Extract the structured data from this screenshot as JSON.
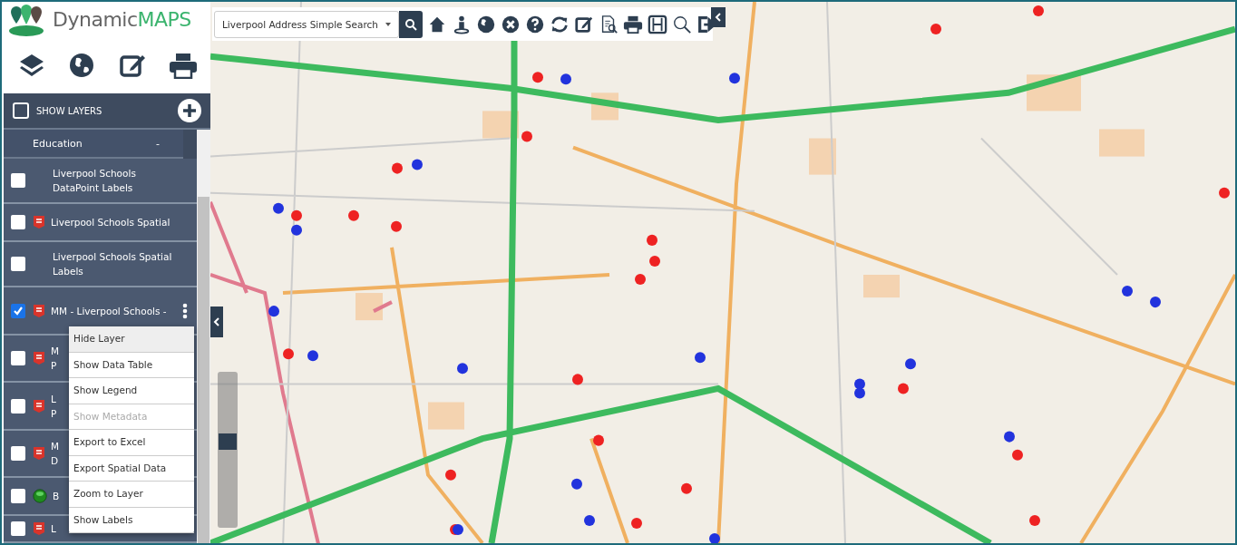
{
  "logo": {
    "part1": "Dynamic",
    "part2": "MAPS"
  },
  "search_source": {
    "value": "Liverpool Address Simple Search"
  },
  "zoom_slider": {
    "level": 0.55
  },
  "layers_panel": {
    "show_layers": {
      "label": "SHOW LAYERS",
      "checked": false
    },
    "group": {
      "label": "Education",
      "toggle": "-"
    },
    "layers": [
      {
        "lines": [
          "Liverpool Schools",
          "DataPoint Labels"
        ],
        "checked": false,
        "kind": "plain"
      },
      {
        "lines": [
          "Liverpool Schools Spatial"
        ],
        "checked": false,
        "kind": "school"
      },
      {
        "lines": [
          "Liverpool Schools Spatial",
          "Labels"
        ],
        "checked": false,
        "kind": "plain"
      },
      {
        "lines": [
          "MM - Liverpool Schools -"
        ],
        "checked": true,
        "kind": "school"
      },
      {
        "lines": [
          "M",
          "P"
        ],
        "checked": false,
        "kind": "school"
      },
      {
        "lines": [
          "L",
          "P"
        ],
        "checked": false,
        "kind": "school"
      },
      {
        "lines": [
          "M",
          "D"
        ],
        "checked": false,
        "kind": "school"
      },
      {
        "lines": [
          "B"
        ],
        "checked": false,
        "kind": "point"
      },
      {
        "lines": [
          "L"
        ],
        "checked": false,
        "kind": "school"
      }
    ]
  },
  "layer_menu": [
    {
      "label": "Hide Layer",
      "selected": true,
      "disabled": false
    },
    {
      "label": "Show Data Table",
      "selected": false,
      "disabled": false
    },
    {
      "label": "Show Legend",
      "selected": false,
      "disabled": false
    },
    {
      "label": "Show Metadata",
      "selected": false,
      "disabled": true
    },
    {
      "label": "Export to Excel",
      "selected": false,
      "disabled": false
    },
    {
      "label": "Export Spatial Data",
      "selected": false,
      "disabled": false
    },
    {
      "label": "Zoom to Layer",
      "selected": false,
      "disabled": false
    },
    {
      "label": "Show Labels",
      "selected": false,
      "disabled": false
    }
  ]
}
